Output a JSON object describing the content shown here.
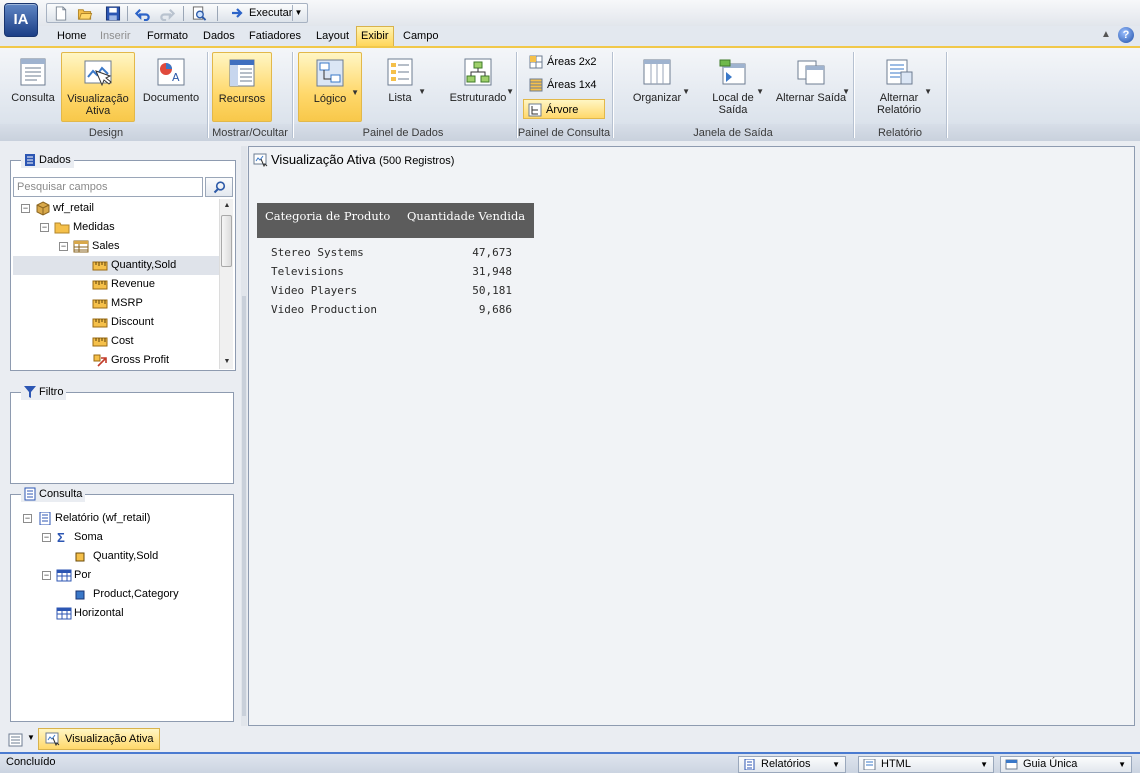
{
  "app": {
    "logo": "IA"
  },
  "quick_access": {
    "run_label": "Executar"
  },
  "tabs": [
    {
      "label": "Home"
    },
    {
      "label": "Inserir",
      "disabled": true
    },
    {
      "label": "Formato"
    },
    {
      "label": "Dados"
    },
    {
      "label": "Fatiadores"
    },
    {
      "label": "Layout"
    },
    {
      "label": "Exibir",
      "active": true
    },
    {
      "label": "Campo"
    }
  ],
  "ribbon": {
    "design": {
      "consulta": "Consulta",
      "visualizacao": "Visualização Ativa",
      "documento": "Documento",
      "group": "Design"
    },
    "mostrar": {
      "recursos": "Recursos",
      "group": "Mostrar/Ocultar"
    },
    "painel_dados": {
      "logico": "Lógico",
      "lista": "Lista",
      "estruturado": "Estruturado",
      "group": "Painel de Dados"
    },
    "painel_consulta": {
      "areas2x2": "Áreas 2x2",
      "areas1x4": "Áreas 1x4",
      "arvore": "Árvore",
      "group": "Painel de Consulta"
    },
    "janela_saida": {
      "organizar": "Organizar",
      "local_saida": "Local de Saída",
      "alternar_saida": "Alternar Saída",
      "group": "Janela de Saída"
    },
    "relatorio": {
      "alternar_relatorio": "Alternar Relatório",
      "group": "Relatório"
    }
  },
  "dados_panel": {
    "title": "Dados",
    "search_placeholder": "Pesquisar campos",
    "tree": [
      {
        "label": "wf_retail",
        "level": 0,
        "expander": "−",
        "icon": "cube-icon"
      },
      {
        "label": "Medidas",
        "level": 1,
        "expander": "−",
        "icon": "folder-icon"
      },
      {
        "label": "Sales",
        "level": 2,
        "expander": "−",
        "icon": "table-icon"
      },
      {
        "label": "Quantity,Sold",
        "level": 3,
        "icon": "measure-icon",
        "selected": true
      },
      {
        "label": "Revenue",
        "level": 3,
        "icon": "measure-icon"
      },
      {
        "label": "MSRP",
        "level": 3,
        "icon": "measure-icon"
      },
      {
        "label": "Discount",
        "level": 3,
        "icon": "measure-icon"
      },
      {
        "label": "Cost",
        "level": 3,
        "icon": "measure-icon"
      },
      {
        "label": "Gross Profit",
        "level": 3,
        "icon": "computed-icon"
      }
    ]
  },
  "filtro_panel": {
    "title": "Filtro"
  },
  "consulta_panel": {
    "title": "Consulta",
    "tree": [
      {
        "label": "Relatório (wf_retail)",
        "level": 0,
        "expander": "−",
        "icon": "report-icon"
      },
      {
        "label": "Soma",
        "level": 1,
        "expander": "−",
        "icon": "sigma-icon"
      },
      {
        "label": "Quantity,Sold",
        "level": 2,
        "icon": "field-icon"
      },
      {
        "label": "Por",
        "level": 1,
        "expander": "−",
        "icon": "grid-icon"
      },
      {
        "label": "Product,Category",
        "level": 2,
        "icon": "field-icon"
      },
      {
        "label": "Horizontal",
        "level": 1,
        "icon": "grid-icon"
      }
    ]
  },
  "output": {
    "title": "Visualização Ativa",
    "records": "(500 Registros)",
    "report": {
      "headers": [
        "Categoria de Produto",
        "Quantidade Vendida"
      ],
      "rows": [
        [
          "Stereo Systems",
          "47,673"
        ],
        [
          "Televisions",
          "31,948"
        ],
        [
          "Video Players",
          "50,181"
        ],
        [
          "Video Production",
          "9,686"
        ]
      ]
    }
  },
  "window_tabs": {
    "active": "Visualização Ativa"
  },
  "status": {
    "text": "Concluído",
    "dropdowns": [
      "Relatórios",
      "HTML",
      "Guia Única"
    ]
  }
}
